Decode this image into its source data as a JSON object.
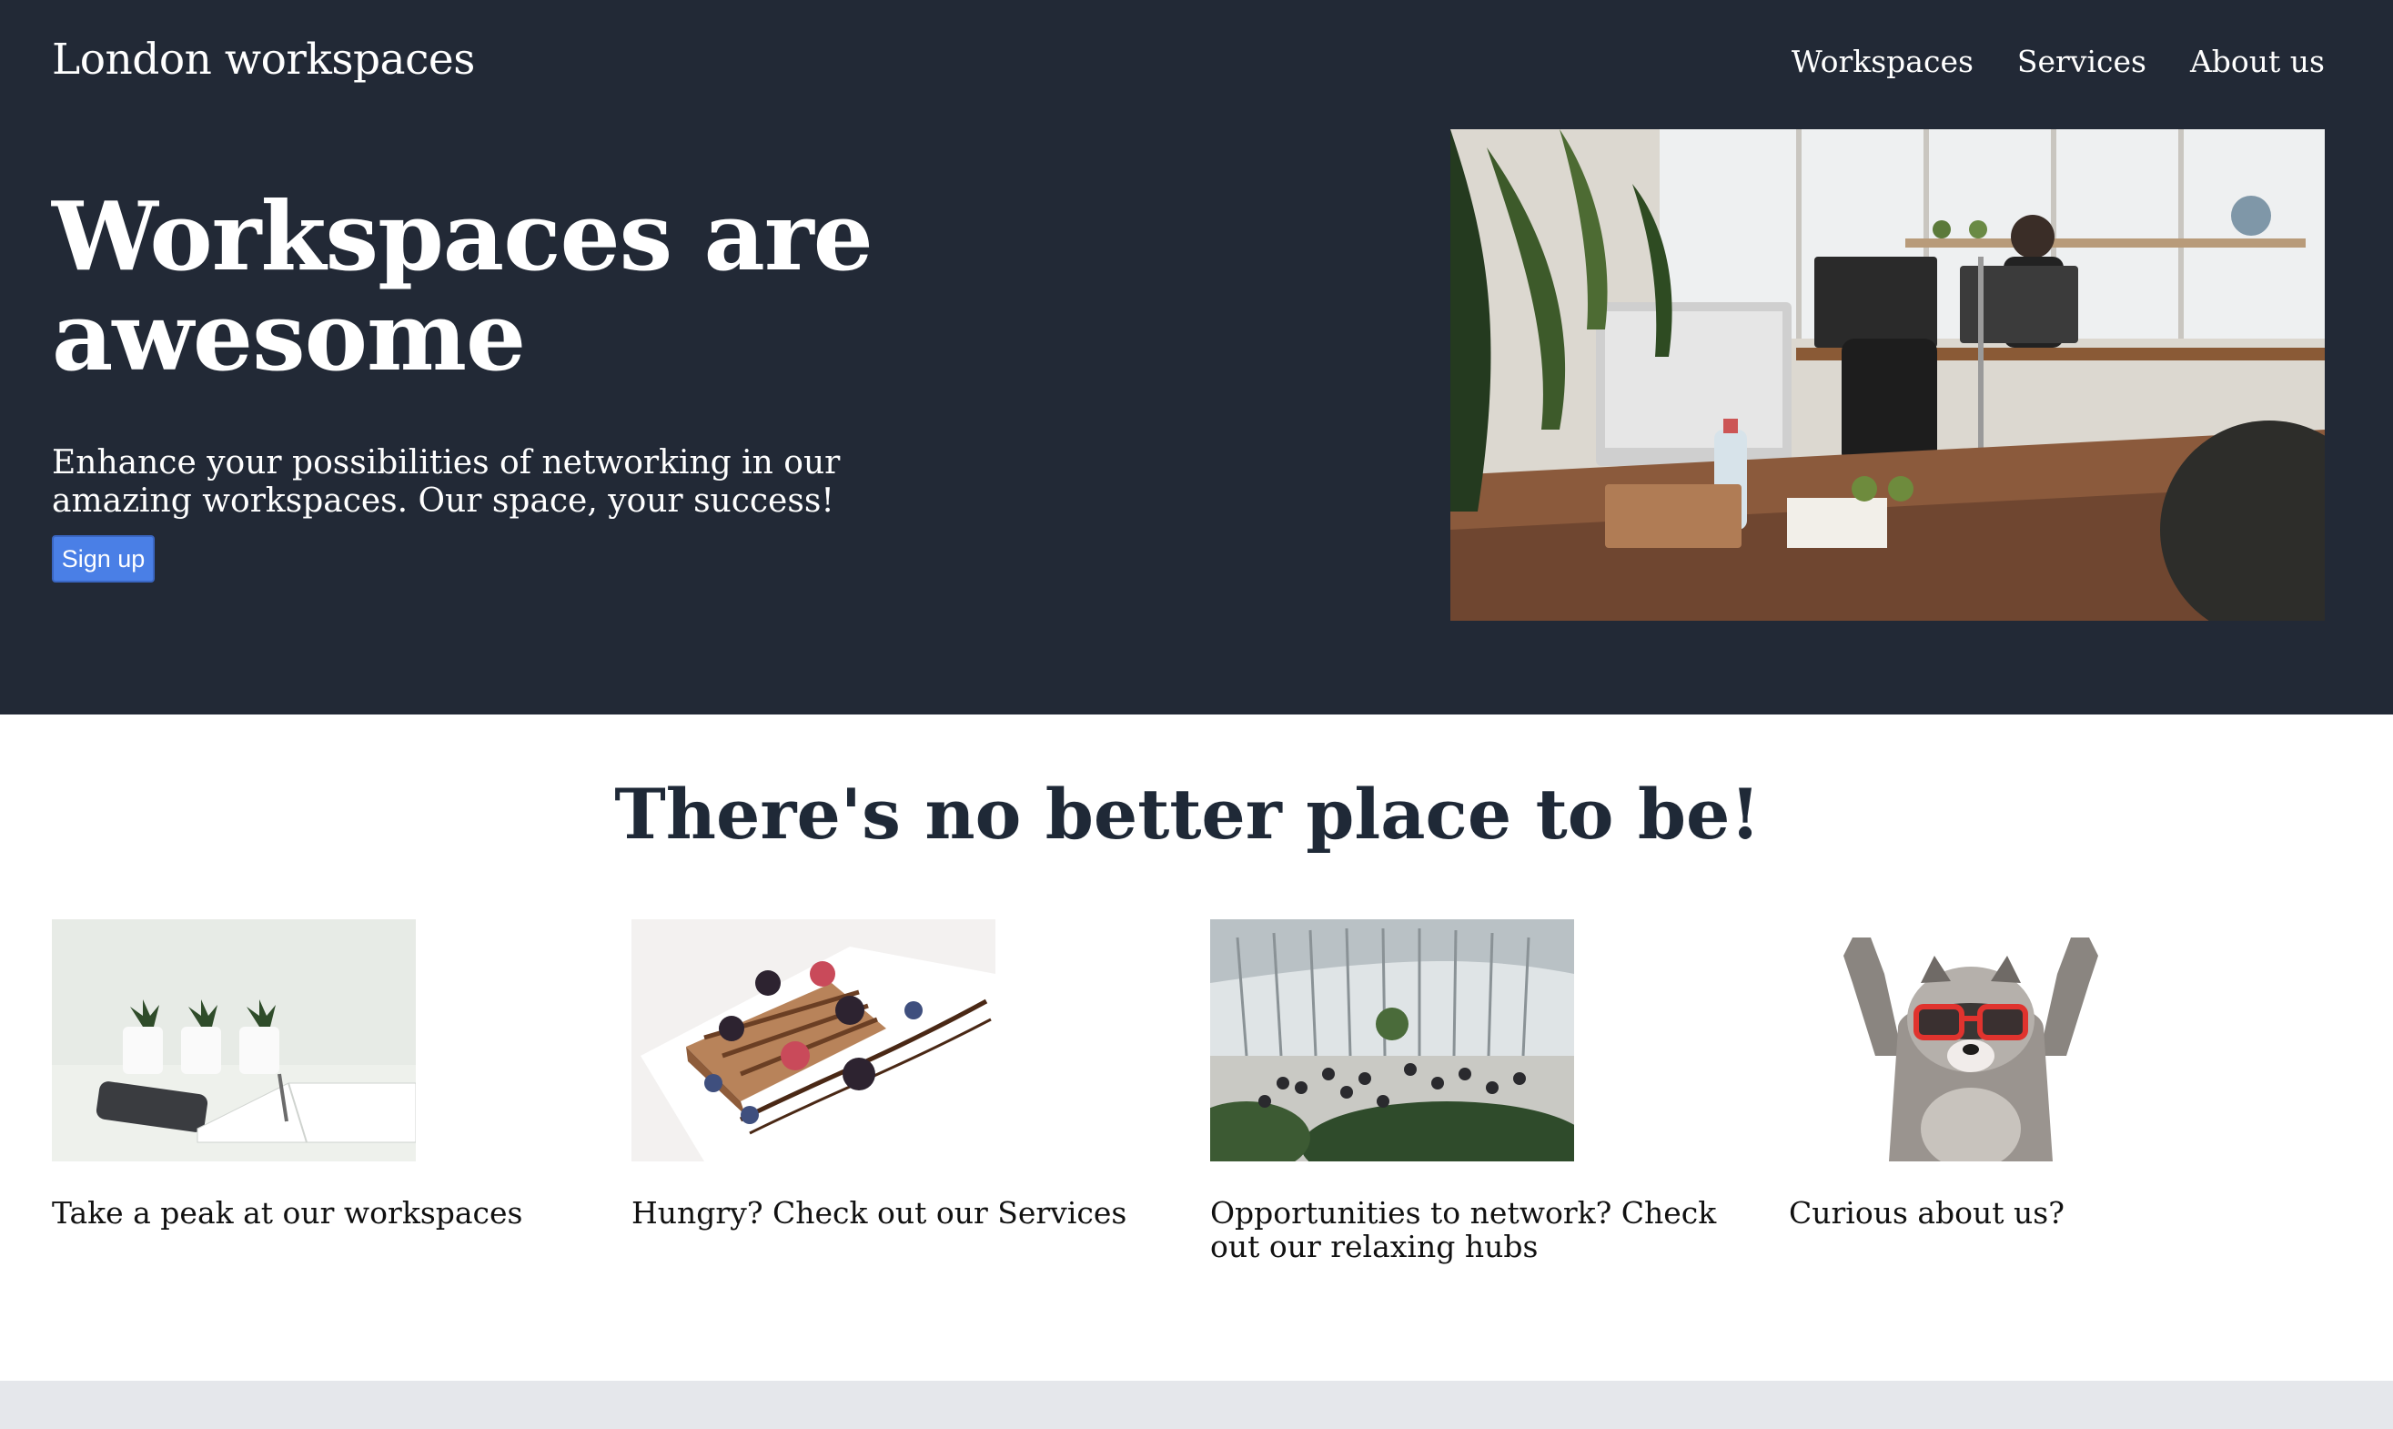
{
  "header": {
    "brand": "London workspaces",
    "nav": [
      "Workspaces",
      "Services",
      "About us"
    ]
  },
  "hero": {
    "title": "Workspaces are awesome",
    "subtitle": "Enhance your possibilities of networking in our amazing workspaces. Our space, your success!",
    "button": "Sign up",
    "image": "office-photo"
  },
  "features": {
    "title": "There's no better place to be!",
    "cards": [
      {
        "image": "plants-notebook-photo",
        "text": "Take a peak at our workspaces"
      },
      {
        "image": "waffles-berries-photo",
        "text": "Hungry? Check out our Services"
      },
      {
        "image": "atrium-people-photo",
        "text": "Opportunities to network? Check out our relaxing hubs"
      },
      {
        "image": "raccoon-sunglasses-photo",
        "text": "Curious about us?"
      }
    ]
  },
  "colors": {
    "hero_bg": "#222936",
    "button": "#4a7fe6",
    "footer": "#e5e7eb"
  }
}
